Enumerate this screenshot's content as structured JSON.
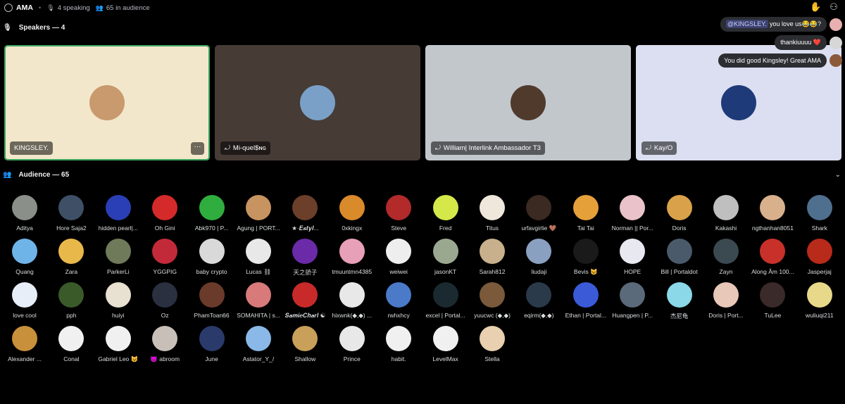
{
  "topbar": {
    "title": "AMA",
    "speaking": "4 speaking",
    "audience": "65 in audience",
    "icons": [
      "stage-icon",
      "mic-icon",
      "people-icon",
      "raise-hand-icon",
      "invite-icon"
    ]
  },
  "speakers": {
    "header": "Speakers — 4",
    "tiles": [
      {
        "name": "KINGSLEY.",
        "bg": "#f3e7cb",
        "avatar": "#c89a6e",
        "muted": false,
        "active": true,
        "more": "···"
      },
      {
        "name": "Mi-quel$ɴɢ",
        "bg": "#463b35",
        "avatar": "#7aa0c7",
        "muted": true,
        "active": false
      },
      {
        "name": "William| Interlink Ambassador T3",
        "bg": "#c2c7cc",
        "avatar": "#4f3a2c",
        "muted": true,
        "active": false
      },
      {
        "name": "Kay/O",
        "bg": "#dcdff1",
        "avatar": "#1e3a78",
        "muted": true,
        "active": false
      }
    ],
    "muted_glyph": "⤾"
  },
  "chat": [
    {
      "mention": "@KINGSLEY.",
      "text": " you love us😂😂?",
      "avatar": "#e8b0b0"
    },
    {
      "mention": "",
      "text": "thankiuuuu ❤️",
      "avatar": "#d7d7d7"
    },
    {
      "mention": "",
      "text": "You did good Kingsley! Great AMA",
      "avatar": "#8a5a3a"
    }
  ],
  "audience": {
    "header": "Audience — 65",
    "members": [
      {
        "name": "Aditya",
        "color": "#8a8f8a"
      },
      {
        "name": "Hore Saja2",
        "color": "#3e4f66"
      },
      {
        "name": "hidden pearl|...",
        "color": "#2a3fb5"
      },
      {
        "name": "Oh Gini",
        "color": "#d42a2a"
      },
      {
        "name": "Abk970 | P...",
        "color": "#2fae3f"
      },
      {
        "name": "Agung | PORT...",
        "color": "#c79360"
      },
      {
        "name": "★·𝑬𝒔𝒕𝒚𝒍...",
        "color": "#6b3f2a"
      },
      {
        "name": "0xkingx",
        "color": "#d98a2a"
      },
      {
        "name": "Steve",
        "color": "#b22a2a"
      },
      {
        "name": "Fred",
        "color": "#d4e84a"
      },
      {
        "name": "Titus",
        "color": "#efe6dc"
      },
      {
        "name": "urfavgirlie 🤎",
        "color": "#3b2a22"
      },
      {
        "name": "Tai Tai",
        "color": "#e6a03a"
      },
      {
        "name": "Norman || Por...",
        "color": "#e9c3c9"
      },
      {
        "name": "Doris",
        "color": "#d9a24a"
      },
      {
        "name": "Kakashi",
        "color": "#bfbfbf"
      },
      {
        "name": "ngthanhan8051",
        "color": "#d8b08c"
      },
      {
        "name": "Shark",
        "color": "#4f6f8f"
      },
      {
        "name": "Quang",
        "color": "#6fb4e8"
      },
      {
        "name": "Zara",
        "color": "#e8b84a"
      },
      {
        "name": "ParkerLi",
        "color": "#6f7a5a"
      },
      {
        "name": "YGGPIG",
        "color": "#c22a3a"
      },
      {
        "name": "baby crypto",
        "color": "#d9d9d9"
      },
      {
        "name": "Lucas ⛓",
        "color": "#e8e8e8"
      },
      {
        "name": "天之骄子",
        "color": "#6b2aa8"
      },
      {
        "name": "tmuuntmn4385",
        "color": "#e8a0b8"
      },
      {
        "name": "weiwei",
        "color": "#eeeeee"
      },
      {
        "name": "jasonKT",
        "color": "#9aa890"
      },
      {
        "name": "Sarah812",
        "color": "#c8b08c"
      },
      {
        "name": "liudaji",
        "color": "#8aa0c0"
      },
      {
        "name": "Bevis 😺",
        "color": "#1a1a1a"
      },
      {
        "name": "HOPE",
        "color": "#e8e8f0"
      },
      {
        "name": "Bill | Portaldot",
        "color": "#4a5a6a"
      },
      {
        "name": "Zayn",
        "color": "#3a4a50"
      },
      {
        "name": "Along Âm 100...",
        "color": "#c8302a"
      },
      {
        "name": "Jasperjaj",
        "color": "#b82a1a"
      },
      {
        "name": "love cool",
        "color": "#e8eef8"
      },
      {
        "name": "pph",
        "color": "#3a5a2a"
      },
      {
        "name": "huiyi",
        "color": "#e8e0d0"
      },
      {
        "name": "Oz",
        "color": "#2a3040"
      },
      {
        "name": "PhamToan66",
        "color": "#6a3a2a"
      },
      {
        "name": "SOMAHITA | s...",
        "color": "#d87a7a"
      },
      {
        "name": "𝑺𝒂𝒎𝒊𝒆𝑪𝒉𝒂𝒓𝒍 ☯",
        "color": "#c82a2a"
      },
      {
        "name": "hixwnk(◆,◆) ...",
        "color": "#e8e8e8"
      },
      {
        "name": "rwhxhcy",
        "color": "#4a7ac8"
      },
      {
        "name": "excel | Portal...",
        "color": "#1a2a30"
      },
      {
        "name": "yuucwc (◆,◆)",
        "color": "#7a5a3a"
      },
      {
        "name": "eqirm(◆,◆)",
        "color": "#2a3a4a"
      },
      {
        "name": "Ethan | Portal...",
        "color": "#3a5ad8"
      },
      {
        "name": "Huangpen | P...",
        "color": "#5a6a7a"
      },
      {
        "name": "杰尼龟",
        "color": "#8ad8e8"
      },
      {
        "name": "Doris | Port...",
        "color": "#e8c8b8"
      },
      {
        "name": "TuLee",
        "color": "#3a2a2a"
      },
      {
        "name": "wuliuqi211",
        "color": "#e8d88a"
      },
      {
        "name": "Alexander ...",
        "color": "#c8903a"
      },
      {
        "name": "Conal",
        "color": "#f0f0f0"
      },
      {
        "name": "Gabriel Leo 😺",
        "color": "#f0f0f0"
      },
      {
        "name": "😈 abroom",
        "color": "#c8c0b8"
      },
      {
        "name": "June",
        "color": "#2a3a6a"
      },
      {
        "name": "Astator_Y_/",
        "color": "#8ab8e8"
      },
      {
        "name": "Shallow",
        "color": "#c8a05a"
      },
      {
        "name": "Prince",
        "color": "#e8e8e8"
      },
      {
        "name": "habit.",
        "color": "#f0f0f0"
      },
      {
        "name": "LevelMax",
        "color": "#f0f0f0"
      },
      {
        "name": "Stella",
        "color": "#e8d0b0"
      }
    ]
  }
}
